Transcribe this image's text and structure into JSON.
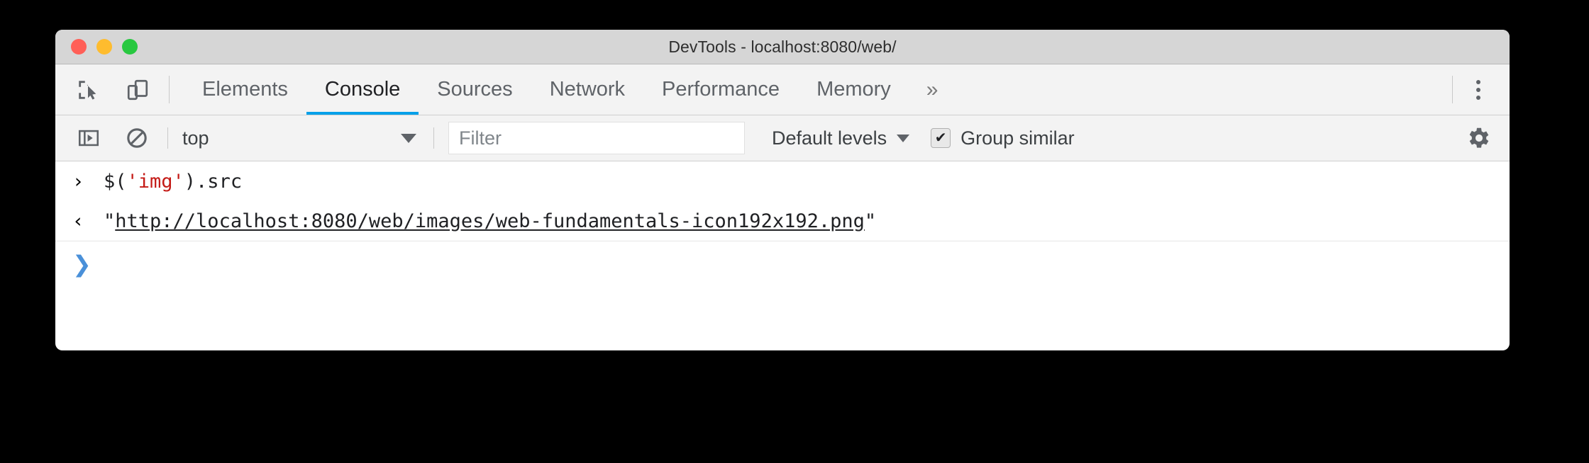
{
  "window": {
    "title": "DevTools - localhost:8080/web/",
    "traffic_lights": [
      {
        "name": "close",
        "color": "#ff5f57"
      },
      {
        "name": "minimize",
        "color": "#febc2e"
      },
      {
        "name": "zoom",
        "color": "#28c840"
      }
    ]
  },
  "tabbar": {
    "icons": [
      {
        "name": "inspect-element-icon",
        "label": "Inspect element"
      },
      {
        "name": "device-toolbar-icon",
        "label": "Toggle device toolbar"
      }
    ],
    "tabs": [
      {
        "label": "Elements",
        "active": false
      },
      {
        "label": "Console",
        "active": true
      },
      {
        "label": "Sources",
        "active": false
      },
      {
        "label": "Network",
        "active": false
      },
      {
        "label": "Performance",
        "active": false
      },
      {
        "label": "Memory",
        "active": false
      }
    ],
    "more_tabs": "»",
    "menu_icon": "more-vertical-icon",
    "active_underline_color": "#00a0e9"
  },
  "console_toolbar": {
    "sidebar_toggle_icon": "console-sidebar-icon",
    "clear_icon": "clear-console-icon",
    "context": {
      "value": "top",
      "caret": "▼"
    },
    "filter": {
      "value": "",
      "placeholder": "Filter"
    },
    "levels": {
      "label": "Default levels",
      "caret": "▼"
    },
    "group_similar": {
      "label": "Group similar",
      "checked": true,
      "check_glyph": "✔"
    },
    "settings_icon": "gear-icon"
  },
  "console": {
    "messages": [
      {
        "type": "input",
        "gutter_glyph": "›",
        "code_prefix": "$(",
        "code_string": "'img'",
        "code_suffix": ").src",
        "full_text": "$('img').src"
      },
      {
        "type": "result",
        "gutter_glyph": "‹",
        "quote_open": "\"",
        "url": "http://localhost:8080/web/images/web-fundamentals-icon192x192.png",
        "quote_close": "\"",
        "full_text": "\"http://localhost:8080/web/images/web-fundamentals-icon192x192.png\""
      }
    ],
    "prompt": {
      "glyph": "❯",
      "value": "",
      "color": "#4a90d9"
    }
  }
}
